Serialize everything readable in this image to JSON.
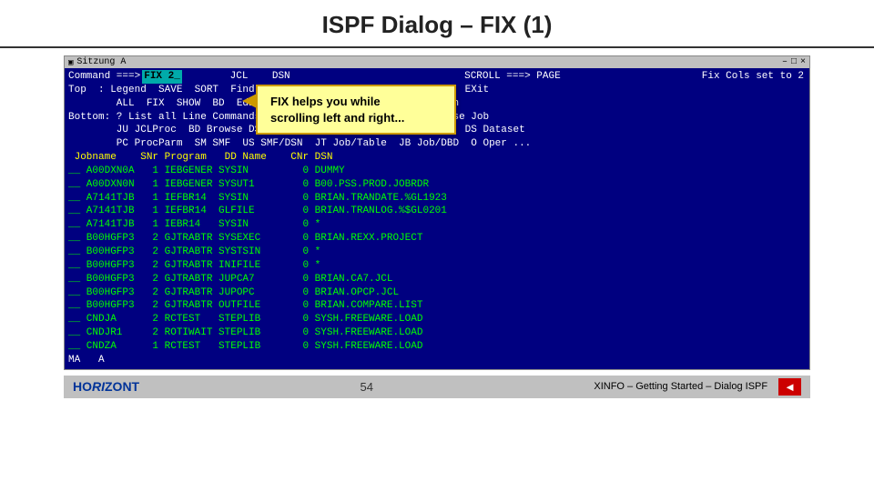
{
  "title": "ISPF Dialog – FIX (1)",
  "terminal": {
    "titlebar": {
      "text": "Sitzung A",
      "controls": [
        "–",
        "□",
        "×"
      ]
    },
    "header_right": "Fix Cols set to 2",
    "command_prompt": "Command ===>",
    "fix_input": "FIX 2_",
    "jcl_dsn": "JCL    DSN",
    "scroll": "SCROLL ===> PAGE",
    "top_line": "Top  : Legend  SAVE  SORT  Find  Select  DP Dependencies  Browse  EXit",
    "all_line": "        ALL  FIX  SHOW  BD  EditSQL              C  Listcat    sh",
    "bottom_line": "Bottom: ? List all Line Commands S Select DP Dependencies B Browse Job",
    "jcl_procs": "        JU JCLProc  BD Browse DSN  C Listcat  J Job  PJ PGM/PROC  DS Dataset",
    "pc_line": "        PC ProcParm  SM SMF  US SMF/DSN  JT Job/Table  JB Job/DBD  O Oper ...",
    "table_header": " Jobname    SNr Program   DD Name    CNr DSN",
    "rows": [
      "__ A00DXN0A   1 IEBGENER SYSIN         0 DUMMY",
      "__ A00DXN0N   1 IEBGENER SYSUT1        0 B00.PSS.PROD.JOBRDR",
      "__ A7141TJB   1 IEFBR14  SYSIN         0 BRIAN.TRANDATE.%GL1923",
      "__ A7141TJB   1 IEFBR14  GLFILE        0 BRIAN.TRANLOG.%$GL0201",
      "__ A7141TJB   1 IEBR14   SYSIN         0 *",
      "__ B00HGFP3   2 GJTRABTR SYSEXEC       0 BRIAN.REXX.PROJECT",
      "__ B00HGFP3   2 GJTRABTR SYSTSIN       0 *",
      "__ B00HGFP3   2 GJTRABTR INIFILE       0 *",
      "__ B00HGFP3   2 GJTRABTR JUPCA7        0 BRIAN.CA7.JCL",
      "__ B00HGFP3   2 GJTRABTR JUPOPC        0 BRIAN.OPCP.JCL",
      "__ B00HGFP3   2 GJTRABTR OUTFILE       0 BRIAN.COMPARE.LIST",
      "__ CNDJA      2 RCTEST   STEPLIB       0 SYSH.FREEWARE.LOAD",
      "__ CNDJR1     2 ROTIWAIT STEPLIB       0 SYSH.FREEWARE.LOAD",
      "__ CNDZA      1 RCTEST   STEPLIB       0 SYSH.FREEWARE.LOAD"
    ],
    "ma_line": "MA   A"
  },
  "tooltip": {
    "line1": "FIX helps you while",
    "line2": "scrolling left and right..."
  },
  "footer": {
    "logo": "HORIZONT",
    "page": "54",
    "nav_text": "XINFO – Getting Started – Dialog ISPF",
    "nav_icon": "◄"
  }
}
